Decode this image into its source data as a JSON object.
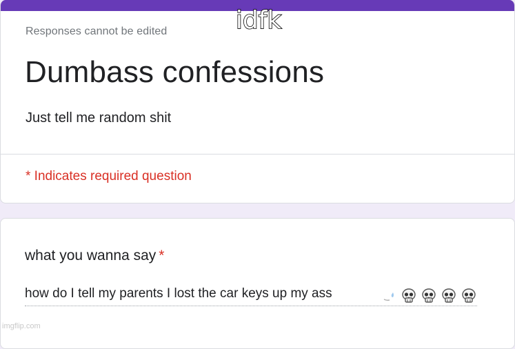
{
  "colors": {
    "accent": "#673ab7",
    "required": "#d93025",
    "background": "#f0ebf8"
  },
  "header": {
    "edit_note": "Responses cannot be edited",
    "title": "Dumbass confessions",
    "description": "Just tell me random shit",
    "required_note": "* Indicates required question"
  },
  "question": {
    "title": "what you wanna say",
    "required_marker": "*",
    "answer_text": "how do I tell my parents I lost the car keys up my ass",
    "emoji_icons": [
      "sweat-drop-icon",
      "skull-icon",
      "skull-icon",
      "skull-icon",
      "skull-icon"
    ]
  },
  "meme": {
    "caption": "idfk",
    "watermark": "imgflip.com"
  }
}
